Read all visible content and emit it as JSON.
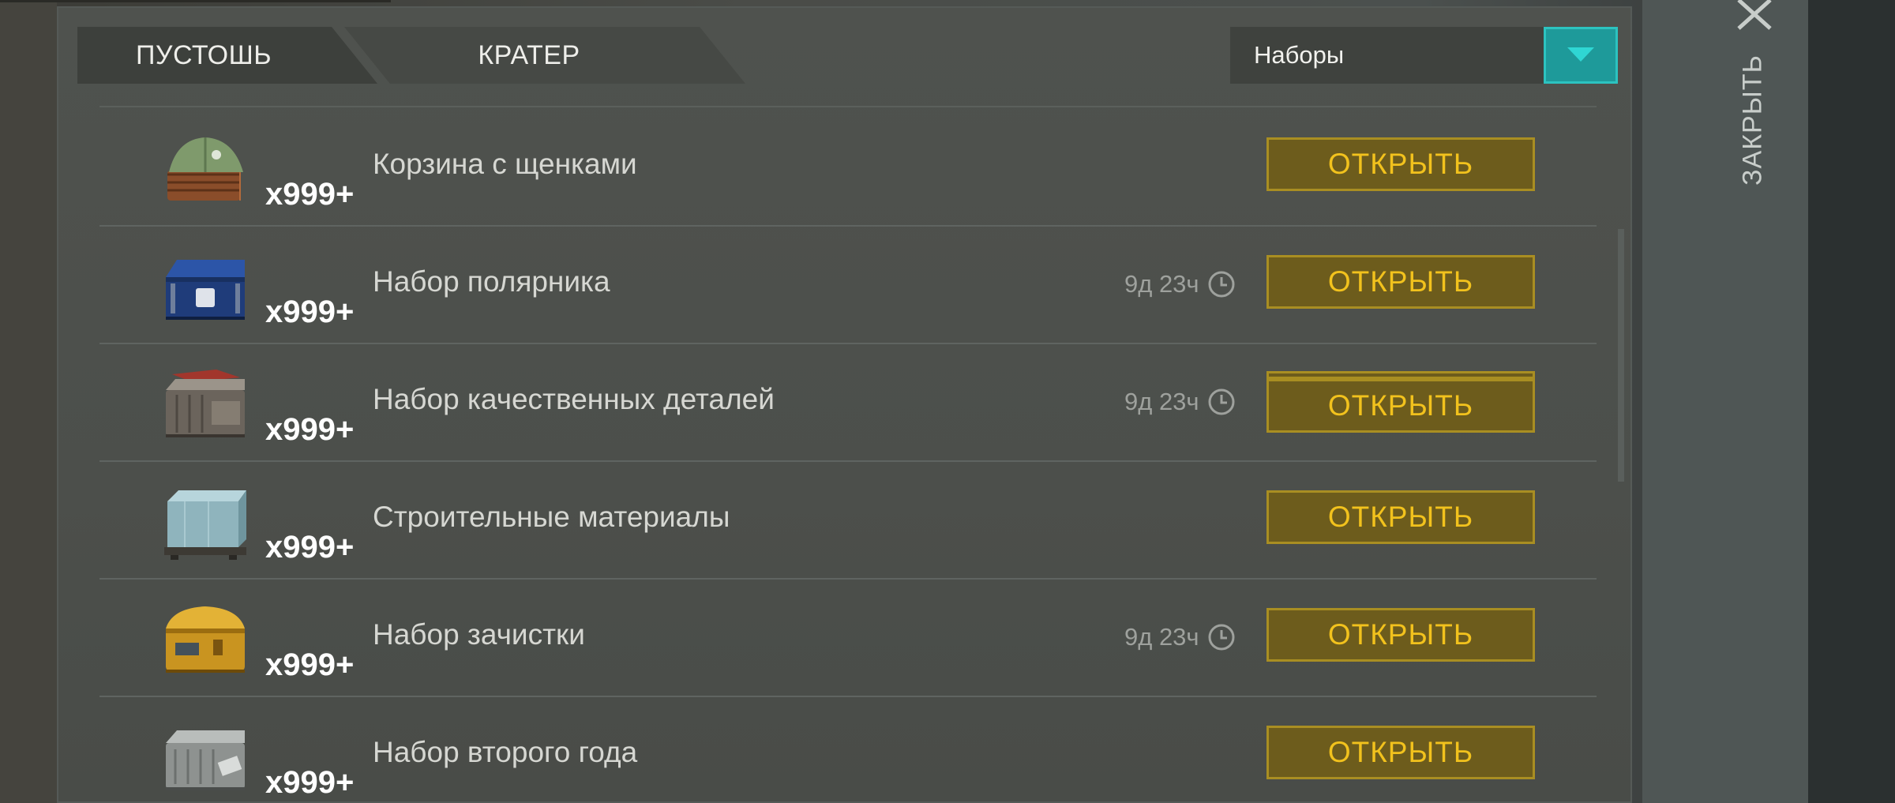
{
  "tabs": [
    {
      "label": "ПУСТОШЬ"
    },
    {
      "label": "КРАТЕР"
    }
  ],
  "filter": {
    "selected": "Наборы",
    "icon": "chevron-down-icon",
    "accent": "#1e9a9a"
  },
  "close": {
    "label": "ЗАКРЫТЬ",
    "icon": "close-icon"
  },
  "items": [
    {
      "name": "Корзина с щенками",
      "qty": "x999+",
      "timer": "",
      "button": "ОТКРЫТЬ",
      "icon": "puppy-basket-icon"
    },
    {
      "name": "Набор полярника",
      "qty": "x999+",
      "timer": "9д 23ч",
      "button": "ОТКРЫТЬ",
      "icon": "polar-chest-icon"
    },
    {
      "name": "Набор качественных деталей",
      "qty": "x999+",
      "timer": "9д 23ч",
      "button": "ОТКРЫТЬ",
      "icon": "parts-crate-icon"
    },
    {
      "name": "Строительные материалы",
      "qty": "x999+",
      "timer": "",
      "button": "ОТКРЫТЬ",
      "icon": "materials-pallet-icon"
    },
    {
      "name": "Набор зачистки",
      "qty": "x999+",
      "timer": "9д 23ч",
      "button": "ОТКРЫТЬ",
      "icon": "yellow-chest-icon"
    },
    {
      "name": "Набор второго года",
      "qty": "x999+",
      "timer": "",
      "button": "ОТКРЫТЬ",
      "icon": "metal-crate-icon"
    }
  ],
  "colors": {
    "button_bg": "#6d5c1c",
    "button_text": "#f2c21d",
    "button_border": "#a98e22"
  }
}
